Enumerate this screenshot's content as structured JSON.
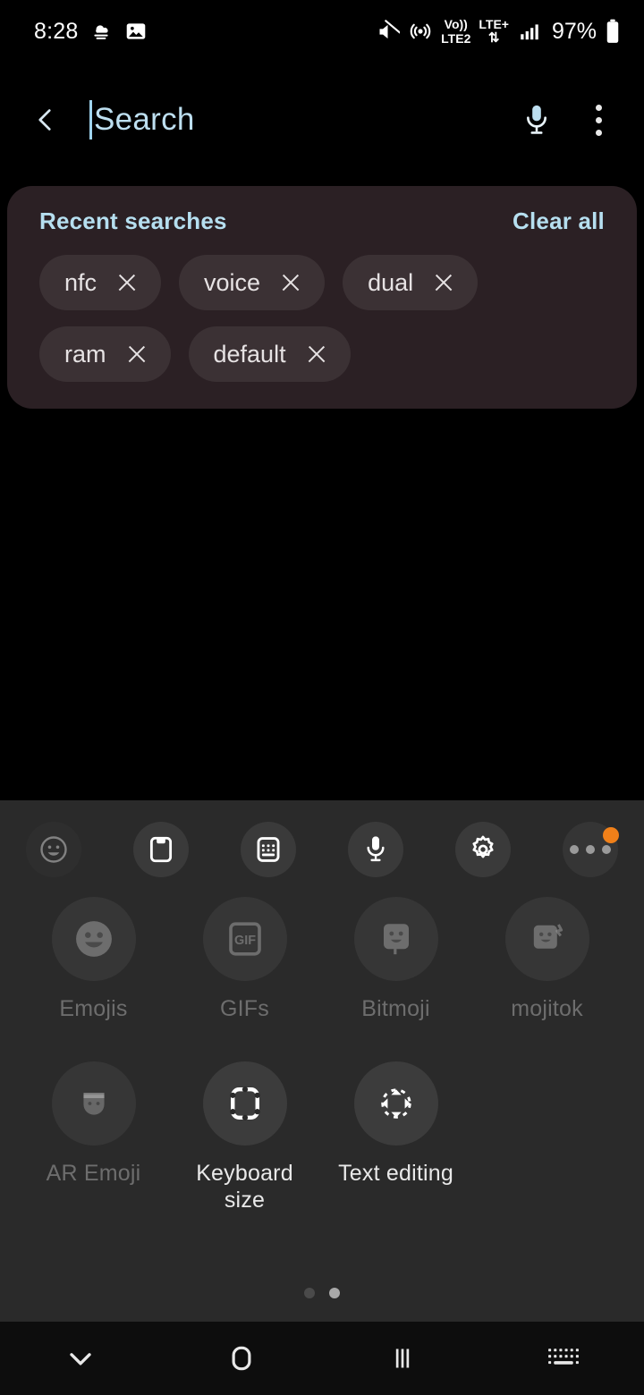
{
  "statusbar": {
    "time": "8:28",
    "battery_percent": "97%",
    "network_voice": "Vo))",
    "network_tech": "LTE2",
    "network_lte": "LTE+",
    "left_icons": [
      "weather-cloud-icon",
      "gallery-image-icon"
    ],
    "right_icons": [
      "mute-icon",
      "hotspot-icon",
      "volte-icon",
      "data-transfer-icon",
      "signal-bars-icon",
      "battery-icon"
    ]
  },
  "searchbar": {
    "back_icon": "chevron-left-icon",
    "placeholder": "Search",
    "value": "",
    "mic_icon": "microphone-icon",
    "overflow_icon": "overflow-menu-icon",
    "accent_color": "#bddff0"
  },
  "recent": {
    "title": "Recent searches",
    "clear_all_label": "Clear all",
    "panel_color": "#2b2024",
    "chip_color": "#3b3134",
    "chips": [
      {
        "label": "nfc"
      },
      {
        "label": "voice"
      },
      {
        "label": "dual"
      },
      {
        "label": "ram"
      },
      {
        "label": "default"
      }
    ]
  },
  "keyboard": {
    "background": "#2a2a2a",
    "toolbar": [
      {
        "name": "sticker-icon",
        "dim": true,
        "badge": false
      },
      {
        "name": "clipboard-icon",
        "dim": false,
        "badge": false
      },
      {
        "name": "one-handed-keyboard-icon",
        "dim": false,
        "badge": false
      },
      {
        "name": "microphone-icon",
        "dim": false,
        "badge": false
      },
      {
        "name": "settings-gear-icon",
        "dim": false,
        "badge": false
      },
      {
        "name": "more-options-icon",
        "dim": false,
        "badge": true
      }
    ],
    "badge_color": "#f08019",
    "row1": [
      {
        "label": "Emojis",
        "icon": "emoji-face-icon",
        "dim": true
      },
      {
        "label": "GIFs",
        "icon": "gif-icon",
        "dim": true
      },
      {
        "label": "Bitmoji",
        "icon": "bitmoji-icon",
        "dim": true
      },
      {
        "label": "mojitok",
        "icon": "mojitok-icon",
        "dim": true
      }
    ],
    "row2": [
      {
        "label": "AR Emoji",
        "icon": "ar-emoji-icon",
        "dim": true
      },
      {
        "label": "Keyboard\nsize",
        "label_line1": "Keyboard",
        "label_line2": "size",
        "icon": "keyboard-size-icon",
        "dim": false
      },
      {
        "label": "Text editing",
        "icon": "text-editing-icon",
        "dim": false
      }
    ],
    "pages": 2,
    "active_page": 2
  },
  "navbar": {
    "items": [
      {
        "name": "hide-keyboard-icon"
      },
      {
        "name": "home-icon"
      },
      {
        "name": "recents-icon"
      },
      {
        "name": "keyboard-switcher-icon"
      }
    ]
  }
}
